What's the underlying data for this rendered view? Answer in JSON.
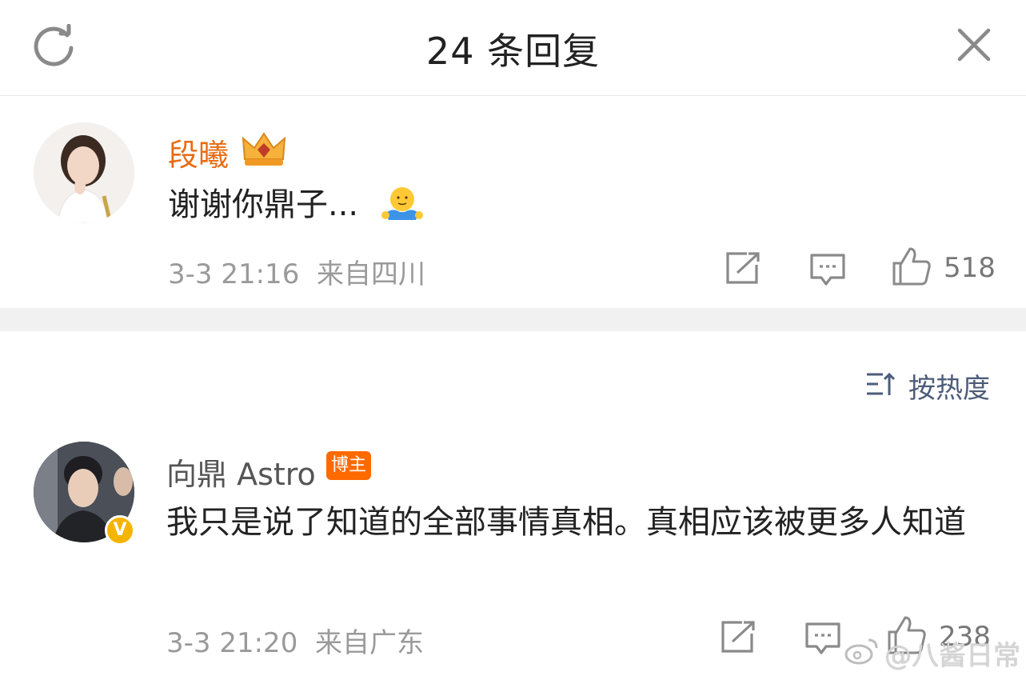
{
  "header": {
    "title": "24 条回复",
    "refresh_icon": "refresh-icon",
    "close_icon": "close-icon"
  },
  "comments": [
    {
      "name": "段曦",
      "name_color": "#e86b12",
      "text": "谢谢你鼎子...",
      "emoji": "hug-emoji",
      "time": "3-3 21:16",
      "source": "来自四川",
      "likes": "518"
    },
    {
      "name": "向鼎 Astro",
      "badge": "博主",
      "verified_badge": "V",
      "text": "我只是说了知道的全部事情真相。真相应该被更多人知道",
      "time": "3-3 21:20",
      "source": "来自广东",
      "likes": "238"
    }
  ],
  "sort": {
    "label": "按热度"
  },
  "watermark": {
    "text": "@八酱日常"
  },
  "colors": {
    "accent_orange": "#ff6a00",
    "link_blue": "#4c5c7a",
    "meta_gray": "#9a9a9a"
  }
}
